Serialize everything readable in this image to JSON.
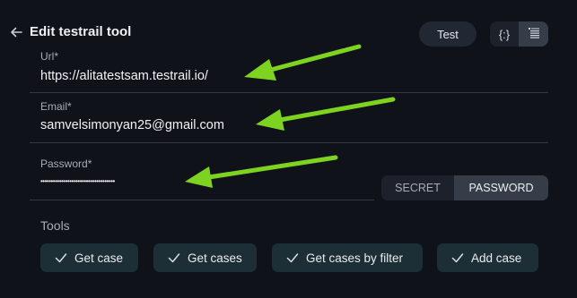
{
  "header": {
    "title": "Edit testrail tool",
    "test_label": "Test",
    "view_json_label": "{:}"
  },
  "fields": {
    "url": {
      "label": "Url*",
      "value": "https://alitatestsam.testrail.io/"
    },
    "email": {
      "label": "Email*",
      "value": "samvelsimonyan25@gmail.com"
    },
    "password": {
      "label": "Password*",
      "value": "••••••••••••••••••••••••••••••••••••"
    }
  },
  "secret_toggle": {
    "secret": "SECRET",
    "password": "PASSWORD",
    "selected": "PASSWORD"
  },
  "tools": {
    "label": "Tools",
    "items": [
      "Get case",
      "Get cases",
      "Get cases by filter",
      "Add case"
    ]
  },
  "colors": {
    "background": "#0f1219",
    "chip": "#1d2f36",
    "arrow": "#7ed321"
  }
}
